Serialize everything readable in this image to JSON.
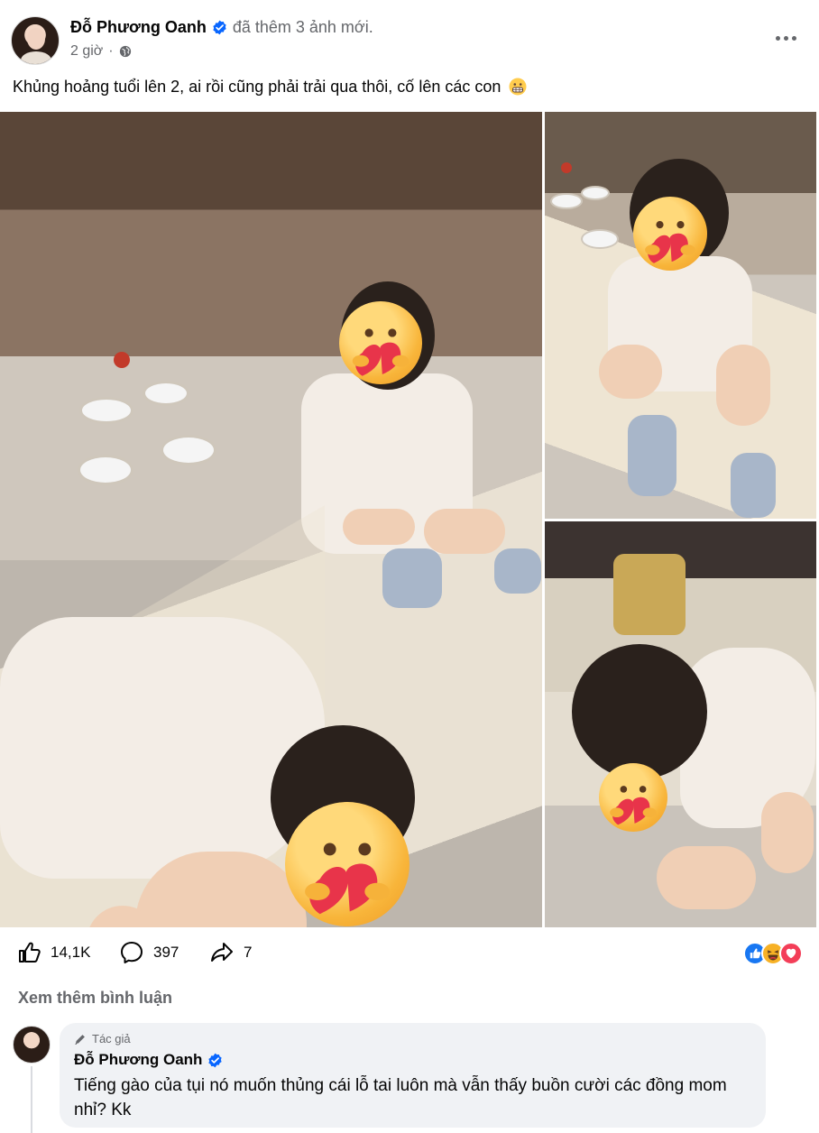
{
  "post": {
    "author": "Đỗ Phương Oanh",
    "action": "đã thêm 3 ảnh mới.",
    "time": "2 giờ",
    "caption": "Khủng hoảng tuổi lên 2, ai rồi cũng phải trải qua thôi, cố lên các con",
    "caption_emoji": "grimacing-face-icon"
  },
  "stats": {
    "likes": "14,1K",
    "comments": "397",
    "shares": "7",
    "reactions": [
      "like",
      "haha",
      "love"
    ]
  },
  "comments_section": {
    "more_comments_label": "Xem thêm bình luận",
    "comment": {
      "badge": "Tác giả",
      "author": "Đỗ Phương Oanh",
      "text": "Tiếng gào của tụi nó muốn thủng cái lỗ tai luôn mà vẫn thấy buồn cười các đồng mom nhỉ? Kk"
    }
  },
  "colors": {
    "verified": "#0866ff",
    "secondary_text": "#65676b",
    "bubble": "#f0f2f5",
    "like": "#1877f2",
    "love": "#f33e58",
    "haha": "#f7b125"
  }
}
